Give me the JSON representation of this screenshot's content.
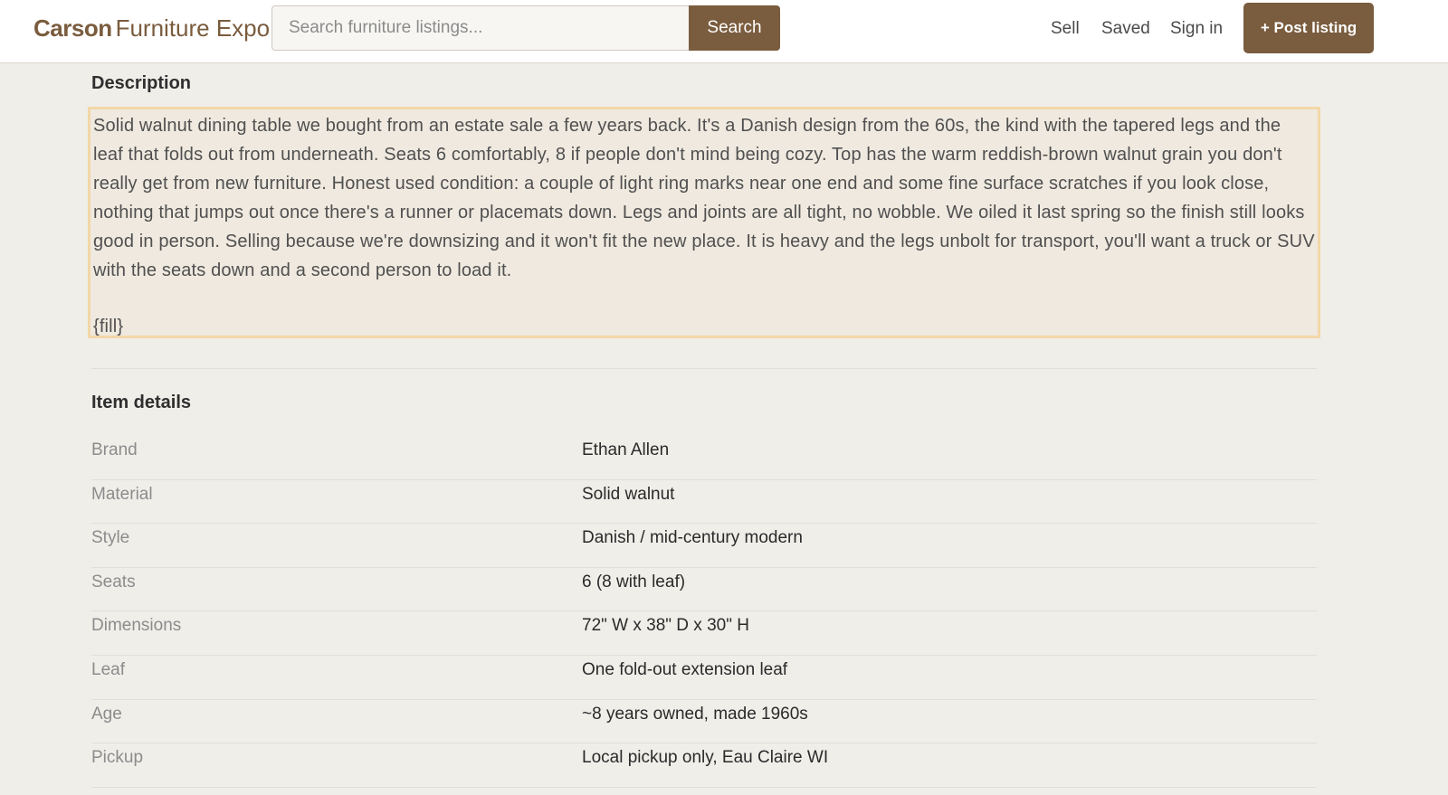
{
  "header": {
    "brand_bold": "Carson",
    "brand_rest": "Furniture Expo",
    "search_placeholder": "Search furniture listings...",
    "search_label": "Search",
    "nav": {
      "sell": "Sell",
      "saved": "Saved",
      "sign_in": "Sign in"
    },
    "post_label": "+ Post listing"
  },
  "description": {
    "title": "Description",
    "text": "Solid walnut dining table we bought from an estate sale a few years back. It's a Danish design from the 60s, the kind with the tapered legs and the leaf that folds out from underneath. Seats 6 comfortably, 8 if people don't mind being cozy. Top has the warm reddish-brown walnut grain you don't really get from new furniture. Honest used condition: a couple of light ring marks near one end and some fine surface scratches if you look close, nothing that jumps out once there's a runner or placemats down. Legs and joints are all tight, no wobble. We oiled it last spring so the finish still looks good in person. Selling because we're downsizing and it won't fit the new place. It is heavy and the legs unbolt for transport, you'll want a truck or SUV with the seats down and a second person to load it.",
    "fill": "{fill}"
  },
  "details": {
    "title": "Item details",
    "rows": [
      {
        "label": "Brand",
        "value": "Ethan Allen"
      },
      {
        "label": "Material",
        "value": "Solid walnut"
      },
      {
        "label": "Style",
        "value": "Danish / mid-century modern"
      },
      {
        "label": "Seats",
        "value": "6 (8 with leaf)"
      },
      {
        "label": "Dimensions",
        "value": "72\" W x 38\" D x 30\" H"
      },
      {
        "label": "Leaf",
        "value": "One fold-out extension leaf"
      },
      {
        "label": "Age",
        "value": "~8 years owned, made 1960s"
      },
      {
        "label": "Pickup",
        "value": "Local pickup only, Eau Claire WI"
      }
    ]
  },
  "colors": {
    "brand": "#7a5c3e",
    "page_bg": "#f0eee9",
    "highlight_border": "#f3d7a8"
  }
}
